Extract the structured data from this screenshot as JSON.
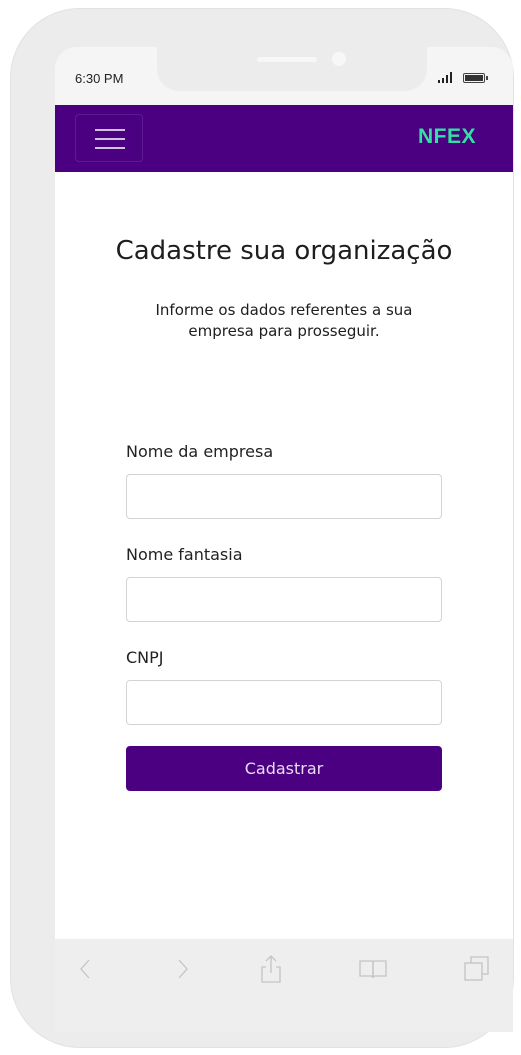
{
  "status_bar": {
    "time": "6:30 PM"
  },
  "header": {
    "brand": "NFEX",
    "menu_icon": "hamburger-icon",
    "background_color": "#4b0082",
    "brand_color": "#34e0a1"
  },
  "page": {
    "title": "Cadastre sua organização",
    "subtitle": "Informe os dados referentes a sua empresa para prosseguir."
  },
  "form": {
    "fields": [
      {
        "label": "Nome da empresa",
        "value": "",
        "placeholder": ""
      },
      {
        "label": "Nome fantasia",
        "value": "",
        "placeholder": ""
      },
      {
        "label": "CNPJ",
        "value": "",
        "placeholder": ""
      }
    ],
    "submit_label": "Cadastrar",
    "submit_color": "#4b0082"
  },
  "toolbar": {
    "icons": [
      "back-icon",
      "forward-icon",
      "share-icon",
      "bookmarks-icon",
      "tabs-icon"
    ]
  }
}
